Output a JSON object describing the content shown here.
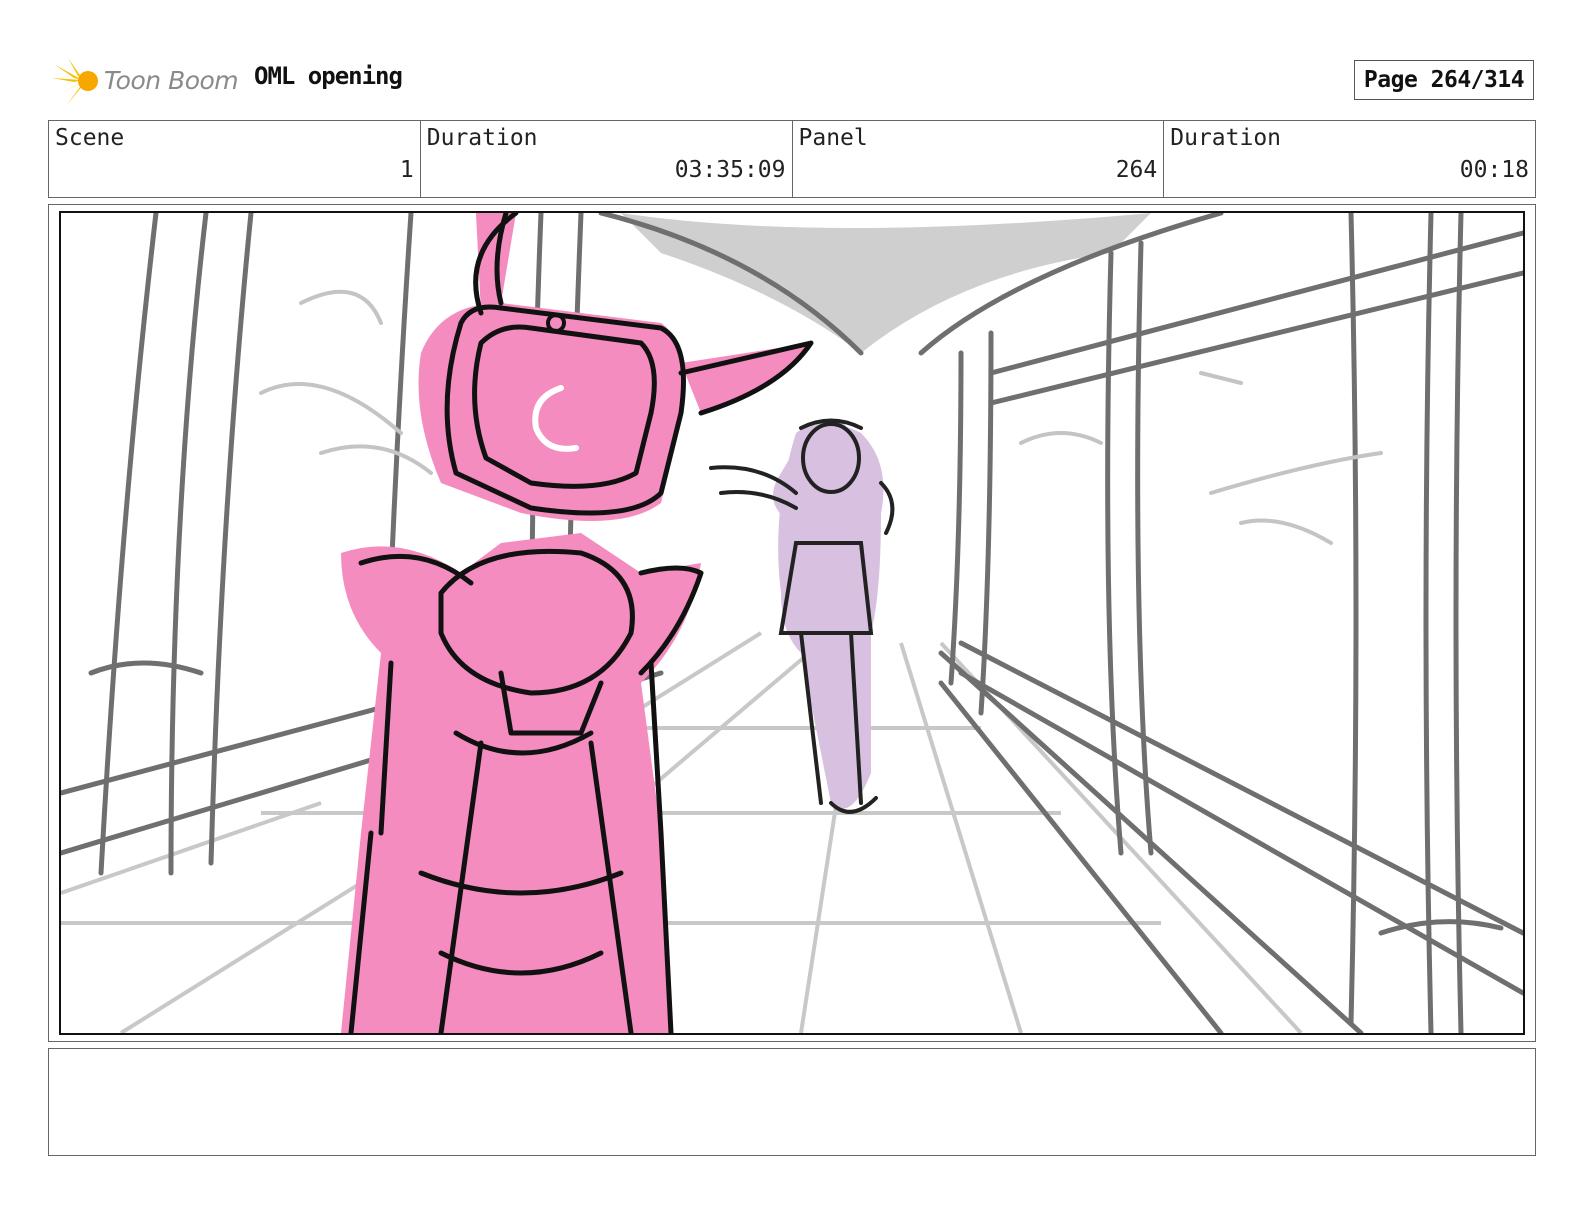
{
  "header": {
    "logo_text": "Toon Boom",
    "project_title": "OML opening",
    "page_label": "Page 264/314"
  },
  "info": {
    "scene_label": "Scene",
    "scene_value": "1",
    "duration_label": "Duration",
    "duration_value": "03:35:09",
    "panel_label": "Panel",
    "panel_value": "264",
    "panel_duration_label": "Duration",
    "panel_duration_value": "00:18"
  },
  "colors": {
    "robot_fill": "#f48cbf",
    "girl_fill": "#d8c0e0",
    "sketch_line": "#777777",
    "logo_accent": "#f5c200"
  },
  "notes": {
    "text": ""
  }
}
